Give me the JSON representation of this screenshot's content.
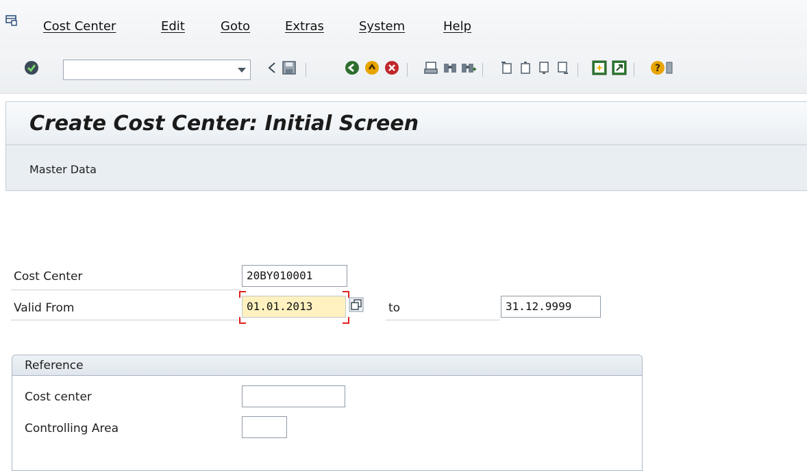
{
  "menu": {
    "items": [
      "Cost Center",
      "Edit",
      "Goto",
      "Extras",
      "System",
      "Help"
    ]
  },
  "toolbar": {
    "command_field_value": "",
    "icons": [
      "enter-icon",
      "back-icon",
      "save-icon",
      "back-nav-icon",
      "exit-icon",
      "cancel-icon",
      "print-icon",
      "find-icon",
      "find-next-icon",
      "first-page-icon",
      "prev-page-icon",
      "next-page-icon",
      "last-page-icon",
      "create-session-icon",
      "shortcut-icon",
      "help-icon"
    ]
  },
  "title": "Create Cost Center: Initial Screen",
  "app_toolbar": {
    "master_data_label": "Master Data"
  },
  "form": {
    "cost_center_label": "Cost Center",
    "cost_center_value": "20BY010001",
    "valid_from_label": "Valid From",
    "valid_from_value": "01.01.2013",
    "to_label": "to",
    "valid_to_value": "31.12.9999"
  },
  "reference": {
    "title": "Reference",
    "cost_center_label": "Cost center",
    "cost_center_value": "",
    "controlling_area_label": "Controlling Area",
    "controlling_area_value": ""
  },
  "colors": {
    "focus_field": "#fff2c0",
    "focus_corner": "#e0201c",
    "enter_icon": "#2e8b2e"
  }
}
